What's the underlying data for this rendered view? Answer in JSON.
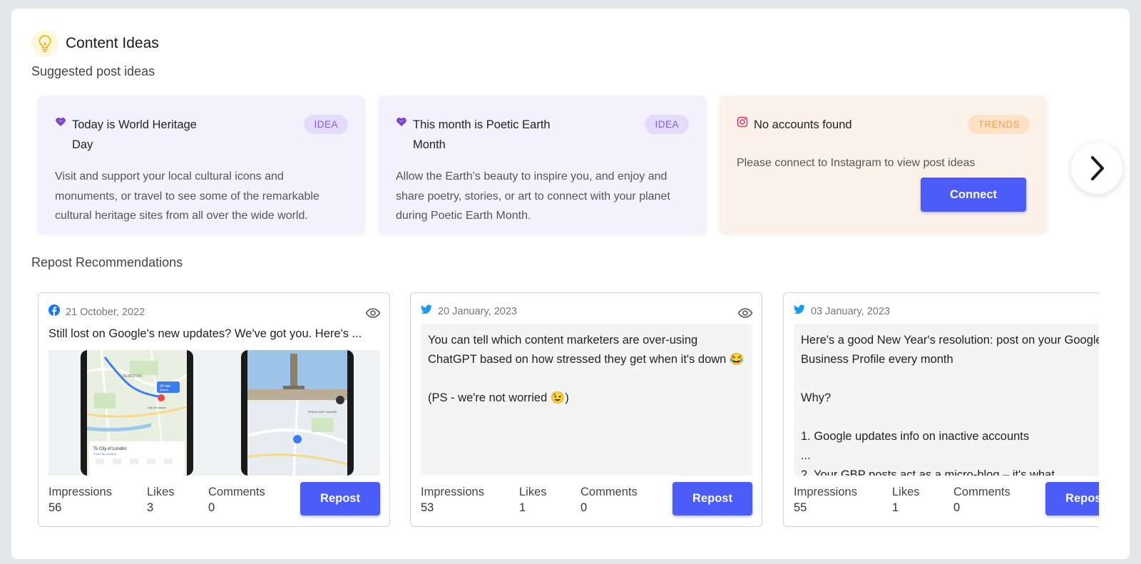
{
  "header": {
    "title": "Content Ideas"
  },
  "sections": {
    "suggested": "Suggested post ideas",
    "repost": "Repost Recommendations"
  },
  "ideas": [
    {
      "title": "Today is World Heritage Day",
      "badge": "IDEA",
      "description": "Visit and support your local cultural icons and monuments, or travel to see some of the remarkable cultural heritage sites from all over the wide world.",
      "icon": "heart-icon"
    },
    {
      "title": "This month is Poetic Earth Month",
      "badge": "IDEA",
      "description": "Allow the Earth’s beauty to inspire you, and enjoy and share poetry, stories, or art to connect with your planet during Poetic Earth Month.",
      "icon": "heart-icon"
    },
    {
      "title": "No accounts found",
      "badge": "TRENDS",
      "description": "Please connect to Instagram to view post ideas",
      "button": "Connect",
      "icon": "instagram-icon"
    }
  ],
  "reposts": [
    {
      "platform": "facebook",
      "date": "21 October, 2022",
      "caption": "Still lost on Google's new updates? We've got you. Here's ...",
      "impressions_label": "Impressions",
      "impressions": "56",
      "likes_label": "Likes",
      "likes": "3",
      "comments_label": "Comments",
      "comments": "0",
      "button": "Repost"
    },
    {
      "platform": "twitter",
      "date": "20 January, 2023",
      "text": "You can tell which content marketers are over-using ChatGPT based on how stressed they get when it's down 😂\n\n(PS - we're not worried 😉)",
      "impressions_label": "Impressions",
      "impressions": "53",
      "likes_label": "Likes",
      "likes": "1",
      "comments_label": "Comments",
      "comments": "0",
      "button": "Repost"
    },
    {
      "platform": "twitter",
      "date": "03 January, 2023",
      "text": "Here's a good New Year's resolution: post on your Google Business Profile every month\n\nWhy?\n\n1. Google updates info on inactive accounts\n...\n2. Your GBP posts act as a micro-blog – it's what",
      "impressions_label": "Impressions",
      "impressions": "55",
      "likes_label": "Likes",
      "likes": "1",
      "comments_label": "Comments",
      "comments": "0",
      "button": "Repost"
    }
  ],
  "media": {
    "map_card_title": "To City of London",
    "map_card_sub": "From My Location",
    "map_eta": "34 min",
    "map_eta2": "fastest",
    "map_label": "ISLINGTON",
    "map_label2": "City of London",
    "map_label3": "TRAFALGAR SQUARE"
  },
  "colors": {
    "accent": "#4c5cf8",
    "idea_bg": "#f3f1fd",
    "trends_bg": "#fdf2ea",
    "twitter": "#1d9bf0",
    "facebook": "#1877f2"
  }
}
